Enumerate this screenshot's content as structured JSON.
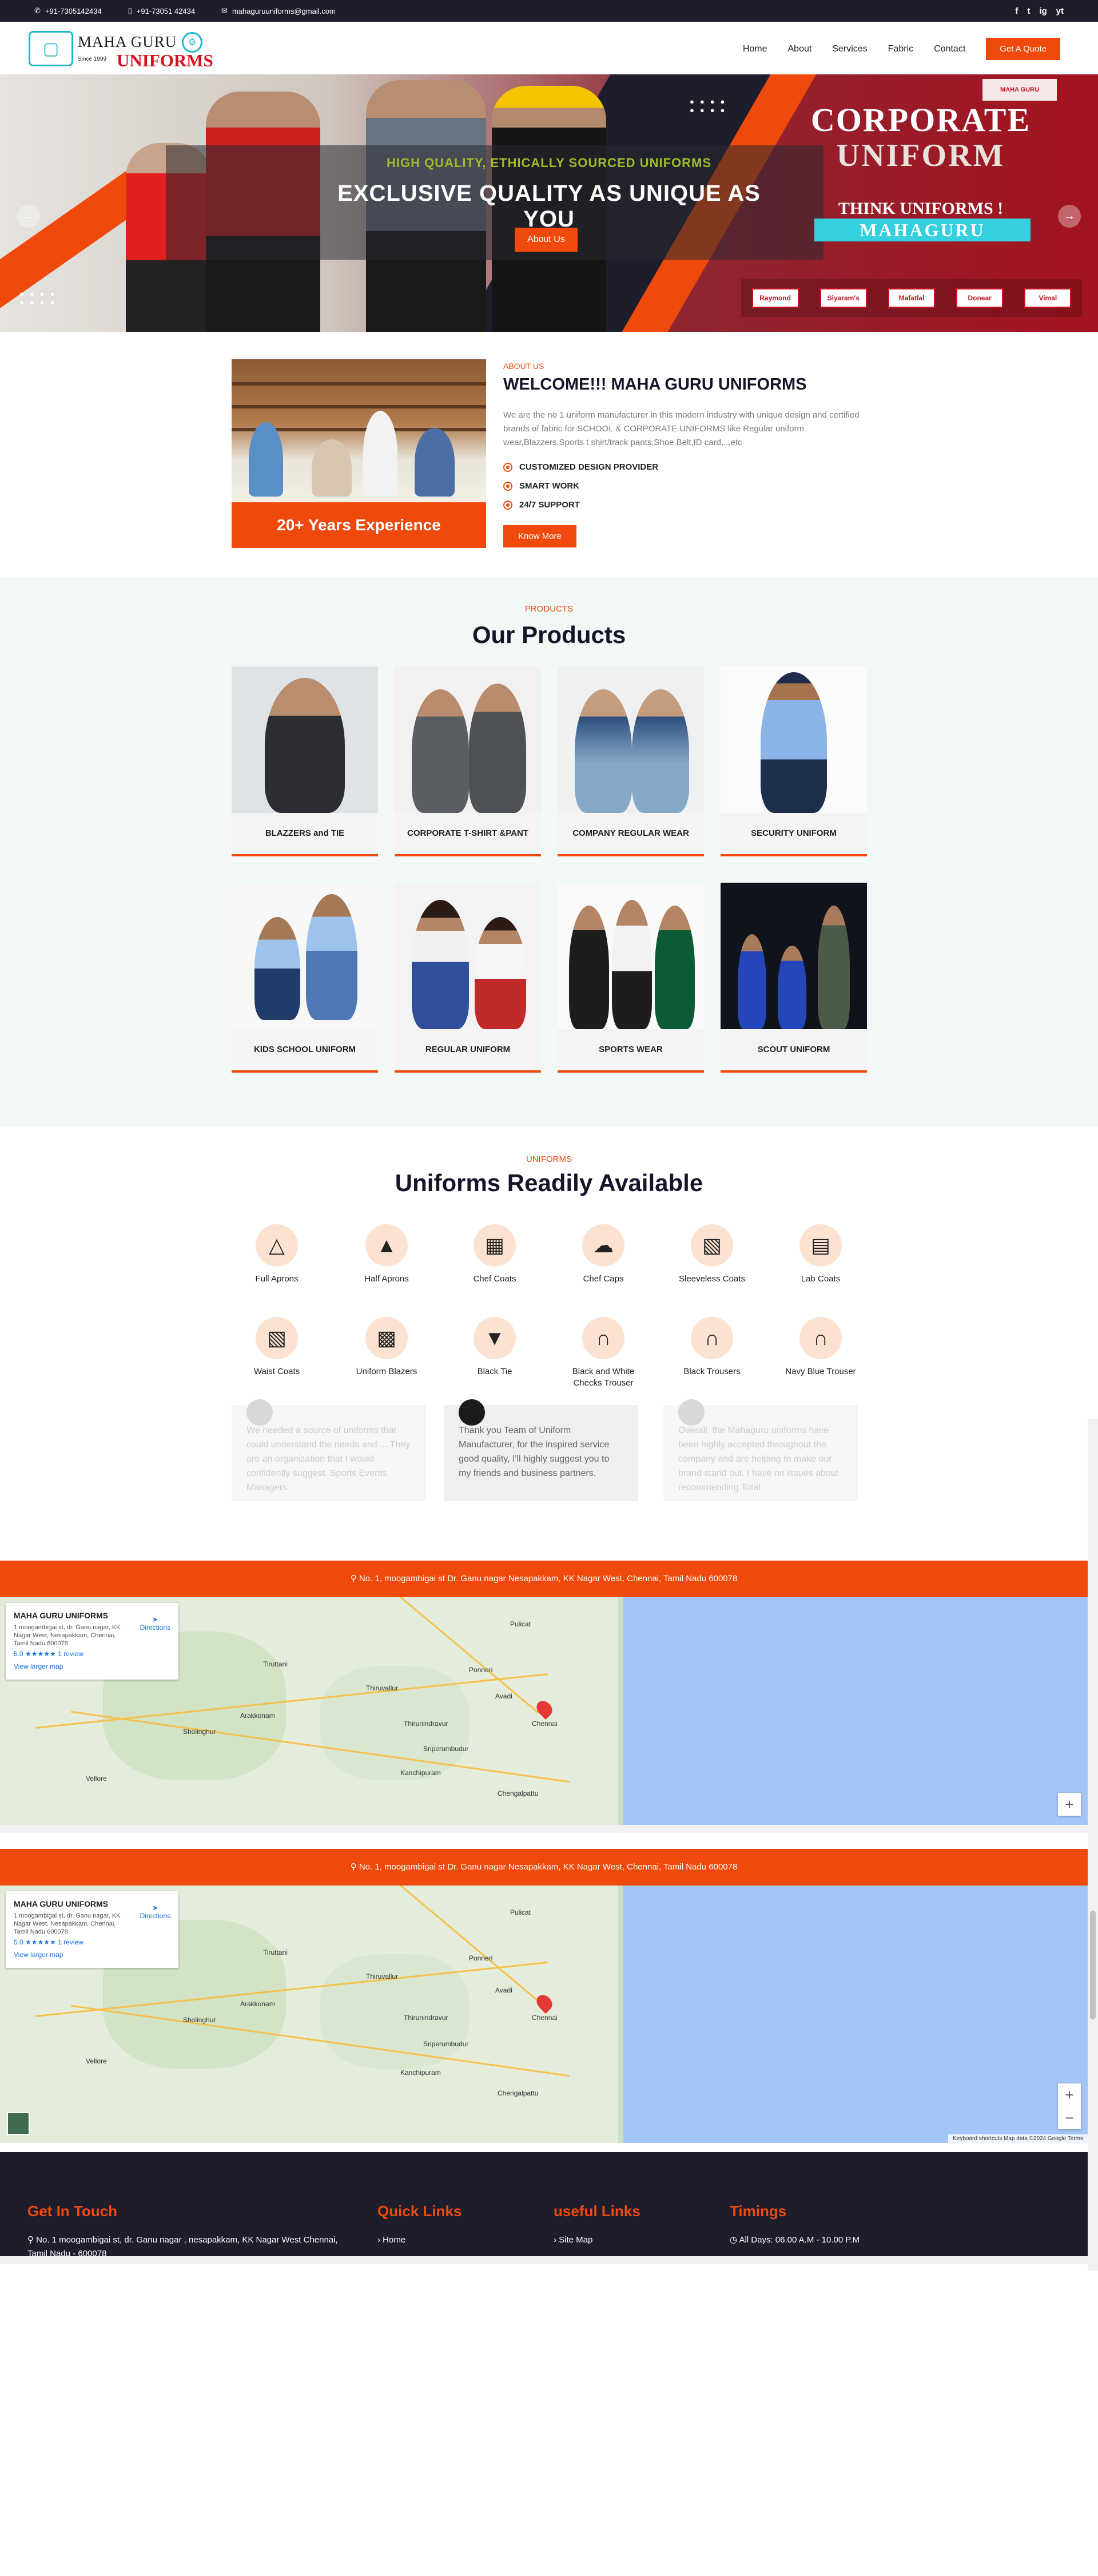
{
  "topbar": {
    "phone1": "+91-7305142434",
    "phone2": "+91-73051 42434",
    "email": "mahaguruuniforms@gmail.com",
    "social": [
      "f",
      "t",
      "ig",
      "yt"
    ]
  },
  "logo": {
    "line1": "MAHA GURU",
    "since": "Since 1999",
    "line2": "UNIFORMS"
  },
  "nav": {
    "items": [
      "Home",
      "About",
      "Services",
      "Fabric",
      "Contact"
    ],
    "cta": "Get A Quote"
  },
  "hero": {
    "tagline": "HIGH QUALITY, ETHICALLY SOURCED UNIFORMS",
    "headline": "EXCLUSIVE QUALITY AS UNIQUE AS YOU",
    "button": "About Us",
    "banner_line1": "CORPORATE",
    "banner_line2": "UNIFORM",
    "think": "THINK UNIFORMS !",
    "brand": "MAHAGURU",
    "mini_logo": "MAHA GURU",
    "partner_brands": [
      "Raymond",
      "Siyaram's",
      "Mafatlal",
      "Donear",
      "Vimal"
    ],
    "prev": "←",
    "next": "→"
  },
  "about": {
    "label": "ABOUT US",
    "title": "WELCOME!!! MAHA GURU UNIFORMS",
    "description": "We are the no 1 uniform manufacturer in this modern industry with unique design and certified brands of fabric for SCHOOL & CORPORATE UNIFORMS like Regular uniform wear,Blazzers,Sports t shirt/track pants,Shoe,Belt,ID card,...etc",
    "features": [
      "CUSTOMIZED DESIGN PROVIDER",
      "SMART WORK",
      "24/7 SUPPORT"
    ],
    "experience": "20+ Years Experience",
    "button": "Know More"
  },
  "products": {
    "label": "PRODUCTS",
    "title": "Our Products",
    "items": [
      {
        "name": "BLAZZERS and TIE"
      },
      {
        "name": "CORPORATE T-SHIRT &PANT"
      },
      {
        "name": "COMPANY REGULAR WEAR"
      },
      {
        "name": "SECURITY UNIFORM"
      },
      {
        "name": "KIDS SCHOOL UNIFORM"
      },
      {
        "name": "REGULAR UNIFORM"
      },
      {
        "name": "SPORTS WEAR"
      },
      {
        "name": "SCOUT UNIFORM"
      }
    ]
  },
  "uniforms": {
    "label": "UNIFORMS",
    "title": "Uniforms Readily Available",
    "items": [
      {
        "name": "Full Aprons",
        "icon": "apron-icon"
      },
      {
        "name": "Half Aprons",
        "icon": "half-apron-icon"
      },
      {
        "name": "Chef Coats",
        "icon": "chef-coat-icon"
      },
      {
        "name": "Chef Caps",
        "icon": "chef-cap-icon"
      },
      {
        "name": "Sleeveless Coats",
        "icon": "vest-icon"
      },
      {
        "name": "Lab Coats",
        "icon": "lab-coat-icon"
      },
      {
        "name": "Waist Coats",
        "icon": "waistcoat-icon"
      },
      {
        "name": "Uniform Blazers",
        "icon": "blazer-icon"
      },
      {
        "name": "Black Tie",
        "icon": "tie-icon"
      },
      {
        "name": "Black and White Checks Trouser",
        "icon": "trouser-icon"
      },
      {
        "name": "Black Trousers",
        "icon": "trouser-icon"
      },
      {
        "name": "Navy Blue Trouser",
        "icon": "trouser-icon"
      }
    ]
  },
  "testimonials": [
    "We needed a source of uniforms that could understand the needs and ... They are an organization that I would confidently suggest. Sports Events Managers",
    "Thank you Team of Uniform Manufacturer, for the inspired service good quality, I'll highly suggest you to my friends and business partners.",
    "Overall, the Mahaguru uniforms have been highly accepted throughout the company and are helping to make our brand stand out. I have no issues about recommending Total."
  ],
  "address": "No. 1, moogambigai st Dr. Ganu nagar Nesapakkam, KK Nagar West, Chennai, Tamil Nadu 600078",
  "map": {
    "title": "MAHA GURU UNIFORMS",
    "address": "1 moogambigai st, dr. Ganu nagar, KK Nagar West, Nesapakkam, Chennai, Tamil Nadu 600078",
    "rating": "5.0",
    "stars": "★★★★★",
    "reviews": "1 review",
    "larger": "View larger map",
    "directions": "Directions",
    "footer": "Keyboard shortcuts   Map data ©2024 Google   Terms",
    "cities": [
      "Pulicat",
      "Ponneri",
      "Thiruvallur",
      "Avadi",
      "Chennai",
      "Kanchipuram",
      "Vellore",
      "Arakkonam",
      "Chengalpattu",
      "Sholinghur",
      "Tiruttani",
      "Thirunindravur",
      "Sriperumbudur"
    ]
  },
  "footer": {
    "col1_title": "Get In Touch",
    "col1_item": "No. 1 moogambigai st, dr. Ganu nagar , nesapakkam, KK Nagar West Chennai, Tamil Nadu - 600078",
    "col2_title": "Quick Links",
    "col2_item": "Home",
    "col3_title": "useful Links",
    "col3_item": "Site Map",
    "col4_title": "Timings",
    "col4_item": "All Days: 06.00 A.M - 10.00 P.M"
  },
  "colors": {
    "accent": "#ef4a0b",
    "dark": "#1d1d2c",
    "brand_teal": "#1fb7c7"
  }
}
